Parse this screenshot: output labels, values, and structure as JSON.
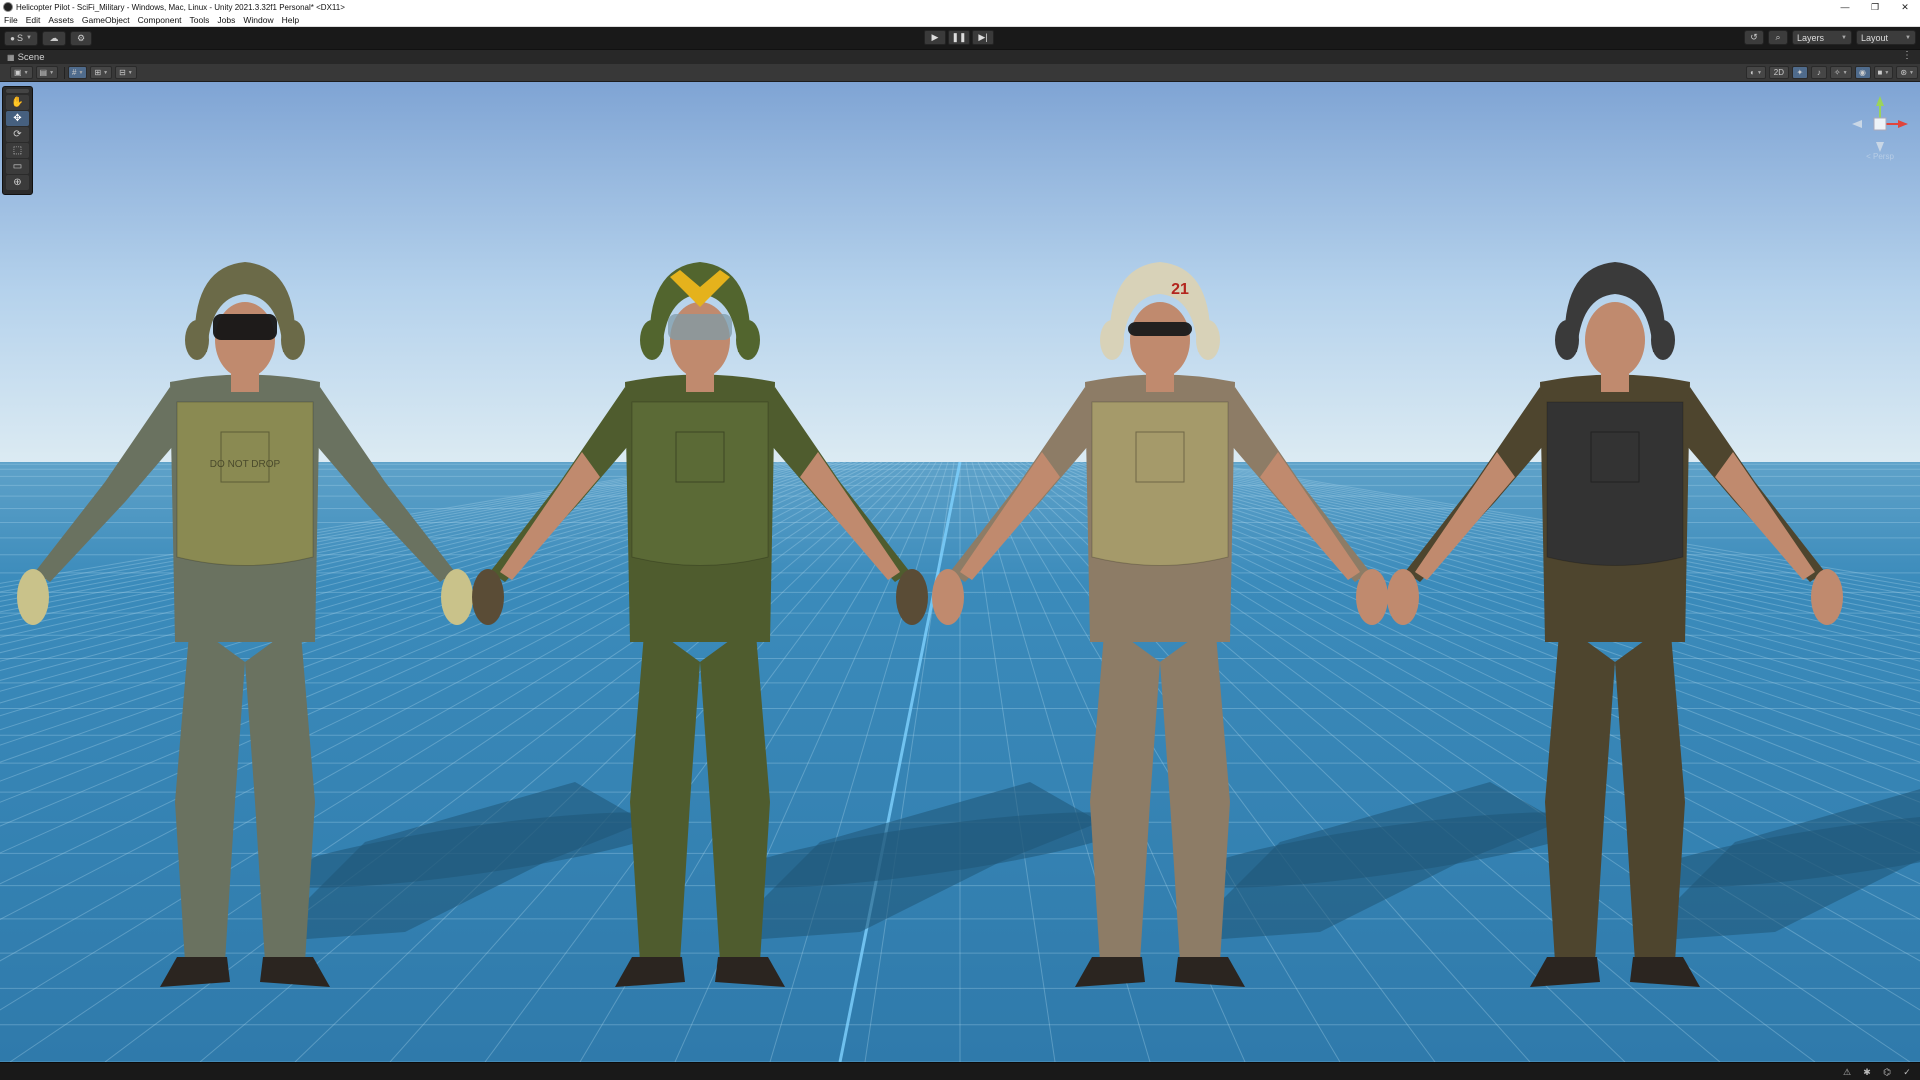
{
  "window": {
    "title": "Helicopter Pilot - SciFi_Military - Windows, Mac, Linux - Unity 2021.3.32f1 Personal* <DX11>",
    "controls": [
      "—",
      "❐",
      "✕"
    ]
  },
  "menu": [
    "File",
    "Edit",
    "Assets",
    "GameObject",
    "Component",
    "Tools",
    "Jobs",
    "Window",
    "Help"
  ],
  "toolbar": {
    "account_label": "S",
    "cloud_icon": "cloud-icon",
    "collab_icon": "settings-icon",
    "play_icon": "play-icon",
    "pause_icon": "pause-icon",
    "step_icon": "step-icon",
    "history_icon": "history-icon",
    "search_icon": "search-icon",
    "layers_label": "Layers",
    "layout_label": "Layout"
  },
  "scene_tab": {
    "label": "Scene",
    "more": "⋮"
  },
  "scene_toolbar": {
    "toggle_2d_label": "2D",
    "left_icons": [
      "draw-mode-icon",
      "render-mode-icon",
      "grid-icon",
      "snap-icon",
      "increment-icon"
    ],
    "right_icons": [
      "shading-icon",
      "2d-toggle",
      "lighting-icon",
      "audio-icon",
      "effects-icon",
      "hidden-objects-icon",
      "camera-icon",
      "gizmos-icon"
    ]
  },
  "tools": [
    {
      "name": "hand-tool",
      "glyph": "✋",
      "active": false
    },
    {
      "name": "move-tool",
      "glyph": "✥",
      "active": true
    },
    {
      "name": "rotate-tool",
      "glyph": "⟳",
      "active": false
    },
    {
      "name": "scale-tool",
      "glyph": "⬚",
      "active": false
    },
    {
      "name": "rect-tool",
      "glyph": "▭",
      "active": false
    },
    {
      "name": "transform-tool",
      "glyph": "⊕",
      "active": false
    }
  ],
  "gizmo": {
    "persp_label": "< Persp"
  },
  "scene_content": {
    "pilots": [
      {
        "name": "pilot-1",
        "suit": "#6a7260",
        "vest": "#8a8a52",
        "helmet": "#6b6a48",
        "visor": "#151515",
        "vest_text": "DO NOT DROP"
      },
      {
        "name": "pilot-2",
        "suit": "#4f5c2e",
        "vest": "#5b6a36",
        "helmet": "#52652e",
        "visor": "#7f9ba8",
        "helmet_accent": "#e5b21c"
      },
      {
        "name": "pilot-3",
        "suit": "#8d7c66",
        "vest": "#a59a6a",
        "helmet": "#d8d2b8",
        "visor": "#1a1a1a",
        "helmet_text": "21"
      },
      {
        "name": "pilot-4",
        "suit": "#4e452e",
        "vest": "#333333",
        "helmet": "#3a3a3a",
        "visor": "none"
      }
    ],
    "sky_top": "#7ea3d3",
    "horizon": "#dbe9f2",
    "floor": "#2f7cae"
  },
  "status": {
    "icons": [
      "debug-icon",
      "bug-icon",
      "network-icon",
      "check-icon"
    ]
  }
}
